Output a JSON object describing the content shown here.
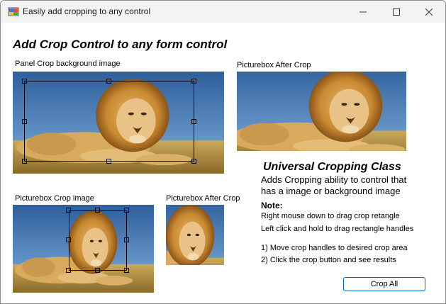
{
  "window": {
    "title": "Easily add cropping to any control"
  },
  "main": {
    "heading": "Add Crop Control to any form control",
    "panel_label": "Panel Crop background image",
    "picturebox_after_label_1": "Picturebox After Crop",
    "picturebox_crop_label": "Picturebox Crop  image",
    "picturebox_after_label_2": "Picturebox After Crop"
  },
  "info": {
    "title": "Universal Cropping Class",
    "desc_line1": "Adds Cropping ability to control that",
    "desc_line2": "has a image or background image",
    "note_title": "Note:",
    "note_line1": "Right mouse down to drag crop retangle",
    "note_line2": "Left click and hold to drag rectangle handles",
    "step1": "1)  Move crop handles to desired crop area",
    "step2": "2)  Click the crop button and see results"
  },
  "buttons": {
    "crop_all": "Crop All"
  },
  "icons": {
    "app": "app-icon",
    "minimize": "minimize-icon",
    "maximize": "maximize-icon",
    "close": "close-icon"
  }
}
